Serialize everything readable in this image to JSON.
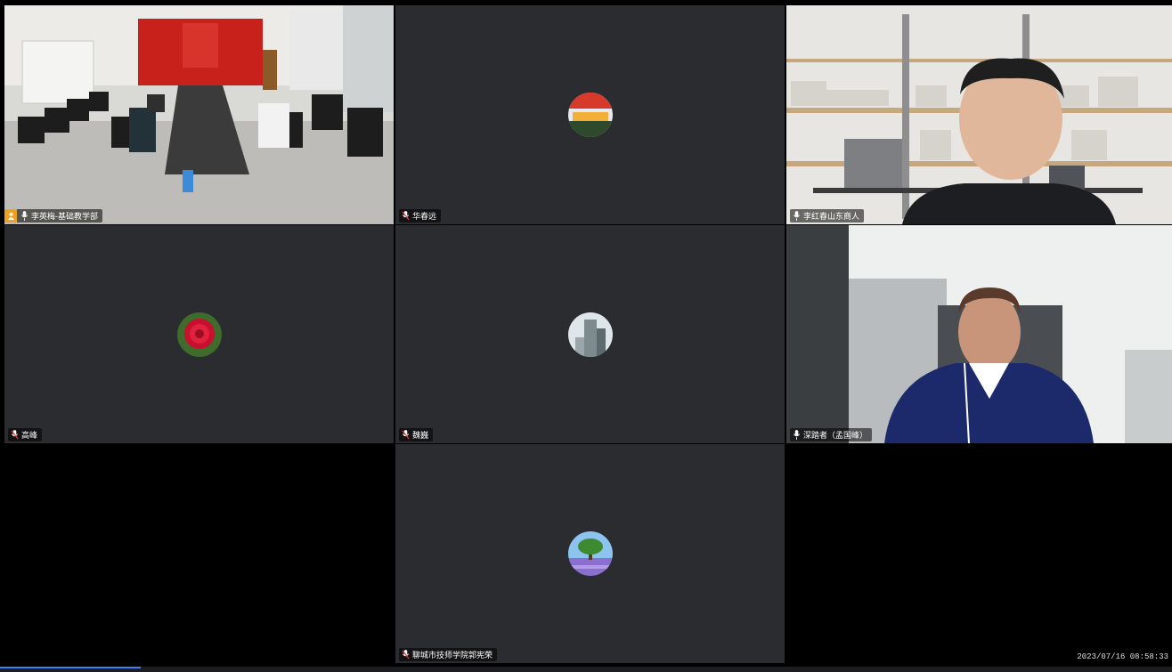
{
  "participants": [
    {
      "id": "p1",
      "name": "李英梅-基础教学部",
      "host": true,
      "view": "video-conference-room"
    },
    {
      "id": "p2",
      "name": "华春远",
      "host": false,
      "view": "avatar",
      "avatar": "flag-scene-icon"
    },
    {
      "id": "p3",
      "name": "李红春山东商人",
      "host": false,
      "view": "video-man-bookshelf"
    },
    {
      "id": "p4",
      "name": "高峰",
      "host": false,
      "view": "avatar",
      "avatar": "red-rose-icon"
    },
    {
      "id": "p5",
      "name": "魏巍",
      "host": false,
      "view": "avatar",
      "avatar": "building-icon"
    },
    {
      "id": "p6",
      "name": "深踏者（孟国峰）",
      "host": false,
      "view": "video-man-office"
    },
    {
      "id": "p7",
      "name": "聊城市技师学院郭宪荣",
      "host": false,
      "view": "avatar",
      "avatar": "tree-field-icon"
    }
  ],
  "timestamp": "2023/07/16 08:58:33",
  "progress_fraction": 0.12,
  "colors": {
    "tile_bg": "#2a2c2f",
    "background": "#000000",
    "host_badge": "#f0a020",
    "active_speaker": "#3ad36a"
  }
}
